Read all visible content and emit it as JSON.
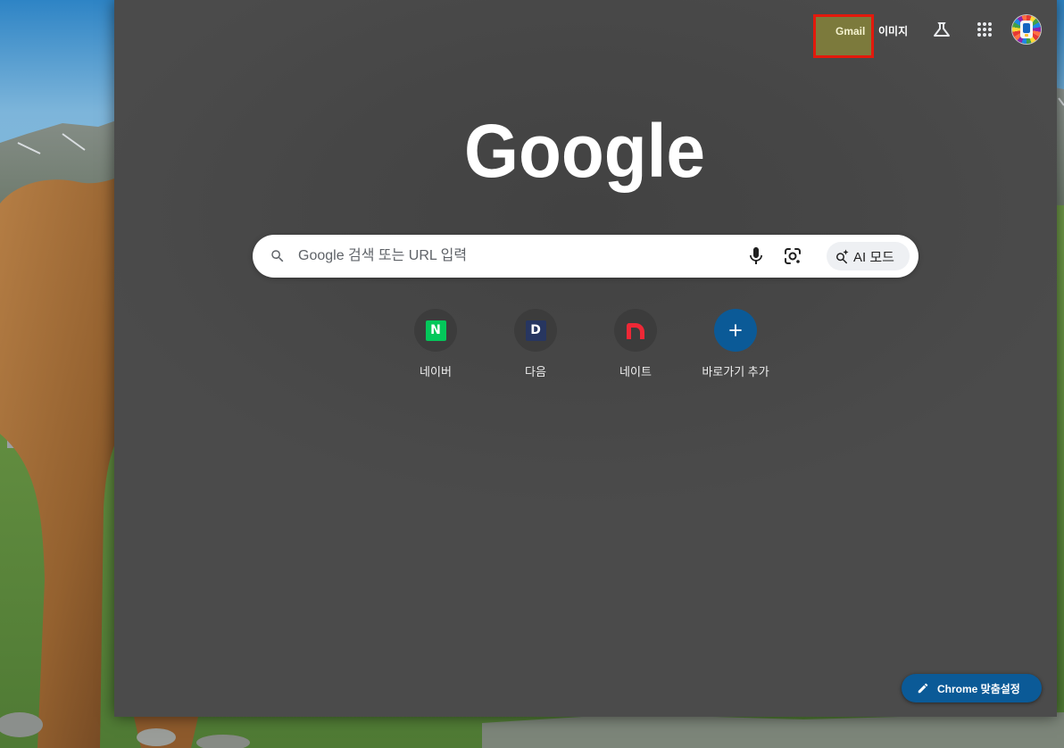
{
  "theme": {
    "window_background": "#4a4a4a",
    "search_background": "#ffffff",
    "placeholder_color": "#5f6368",
    "accent": "#0b5a97"
  },
  "header": {
    "gmail_label": "Gmail",
    "images_label": "이미지",
    "labs_icon": "flask-icon",
    "apps_icon": "apps-grid-icon",
    "avatar_icon": "account-avatar",
    "gmail_highlight": {
      "border_color": "#e3190c",
      "fill_color": "#7c7a3c"
    }
  },
  "logo": {
    "text": "Google"
  },
  "search": {
    "placeholder": "Google 검색 또는 URL 입력",
    "value": "",
    "search_icon": "search-icon",
    "voice_icon": "mic-icon",
    "lens_icon": "lens-icon",
    "ai_mode": {
      "label": "AI 모드",
      "icon": "ai-search-icon"
    }
  },
  "shortcuts": [
    {
      "label": "네이버",
      "icon": "naver-logo",
      "logo_letter": "N",
      "color": "#03c75a"
    },
    {
      "label": "다음",
      "icon": "daum-logo",
      "logo_letter": "D",
      "color": "#273660"
    },
    {
      "label": "네이트",
      "icon": "nate-logo",
      "color": "#ee2836"
    },
    {
      "label": "바로가기 추가",
      "icon": "plus-icon",
      "color": "#0b5a97"
    }
  ],
  "customize_button": {
    "label": "Chrome 맞춤설정",
    "icon": "pencil-icon",
    "color": "#0b5a97"
  }
}
